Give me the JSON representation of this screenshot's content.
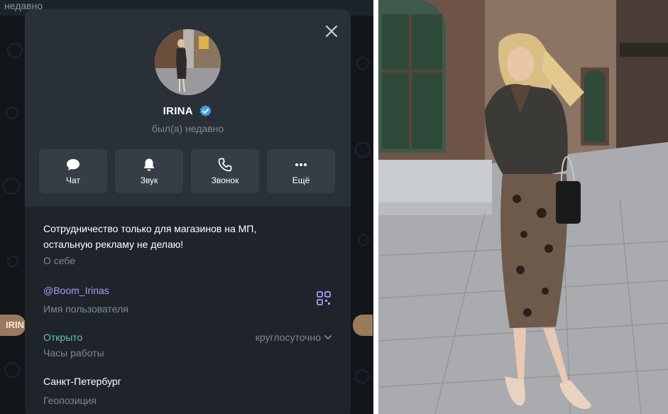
{
  "background_app": {
    "status_text": "недавно",
    "chat_chip_label": "IRIN"
  },
  "profile": {
    "name": "IRINA",
    "last_seen": "был(а) недавно",
    "verified_icon": "verified-badge-icon",
    "actions": [
      {
        "label": "Чат",
        "icon": "chat-bubble-icon"
      },
      {
        "label": "Звук",
        "icon": "bell-icon"
      },
      {
        "label": "Звонок",
        "icon": "phone-icon"
      },
      {
        "label": "Ещё",
        "icon": "more-dots-icon"
      }
    ],
    "bio": {
      "text": "Сотрудничество только для магазинов на МП, остальную рекламу не делаю!",
      "caption": "О себе"
    },
    "username": {
      "value": "@Boom_Irinas",
      "caption": "Имя пользователя"
    },
    "hours": {
      "status": "Открыто",
      "caption": "Часы работы",
      "dropdown_value": "круглосуточно"
    },
    "location": {
      "value": "Санкт-Петербург",
      "caption": "Геопозиция"
    }
  },
  "colors": {
    "modal_bg": "#2a3038",
    "info_bg": "#1f242b",
    "accent_verified": "#4a9fe8",
    "username_link": "#a79cf6",
    "open_status": "#5ec6a0"
  }
}
